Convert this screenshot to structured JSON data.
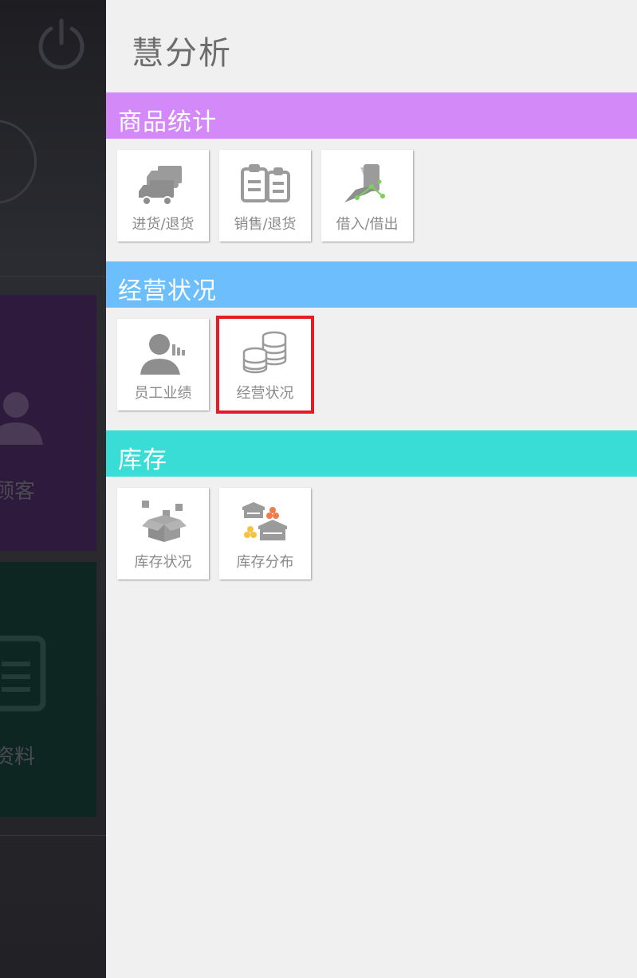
{
  "background_app": {
    "tile_customers_label": "顾客",
    "tile_info_label": "资料"
  },
  "drawer": {
    "title": "慧分析",
    "sections": [
      {
        "header": "商品统计",
        "color": "#d38af8",
        "tiles": [
          {
            "label": "进货/退货",
            "icon": "truck-icon"
          },
          {
            "label": "销售/退货",
            "icon": "clipboard-icon"
          },
          {
            "label": "借入/借出",
            "icon": "hand-phone-icon"
          }
        ]
      },
      {
        "header": "经营状况",
        "color": "#6cbefc",
        "tiles": [
          {
            "label": "员工业绩",
            "icon": "employee-chart-icon"
          },
          {
            "label": "经营状况",
            "icon": "coin-stacks-icon",
            "selected": true
          }
        ]
      },
      {
        "header": "库存",
        "color": "#3adcd6",
        "tiles": [
          {
            "label": "库存状况",
            "icon": "open-box-icon"
          },
          {
            "label": "库存分布",
            "icon": "warehouse-icon"
          }
        ]
      }
    ]
  },
  "colors": {
    "highlight": "#e41c24"
  }
}
